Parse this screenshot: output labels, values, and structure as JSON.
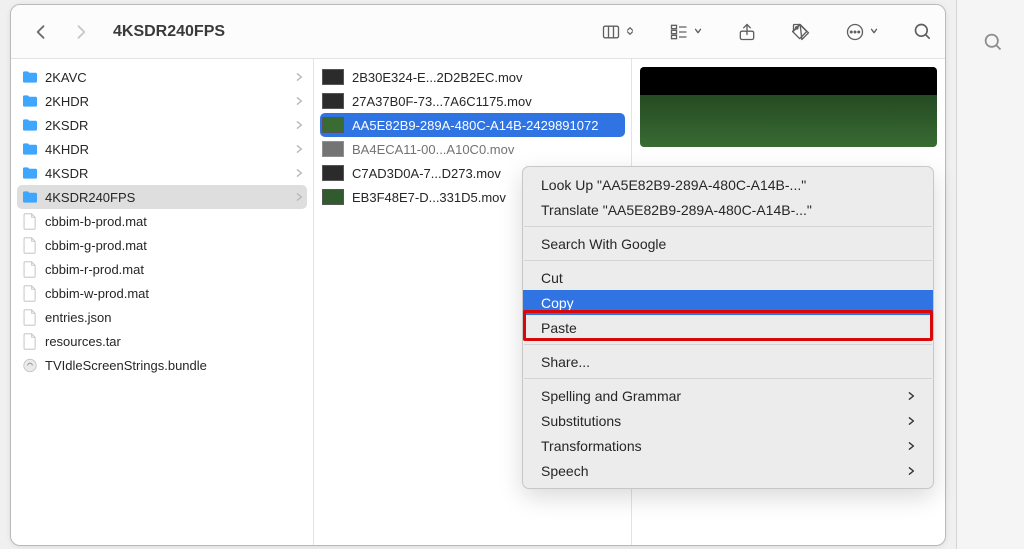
{
  "toolbar": {
    "title": "4KSDR240FPS"
  },
  "sidebar": {
    "items": [
      {
        "name": "2KAVC",
        "type": "folder",
        "selected": false
      },
      {
        "name": "2KHDR",
        "type": "folder",
        "selected": false
      },
      {
        "name": "2KSDR",
        "type": "folder",
        "selected": false
      },
      {
        "name": "4KHDR",
        "type": "folder",
        "selected": false
      },
      {
        "name": "4KSDR",
        "type": "folder",
        "selected": false
      },
      {
        "name": "4KSDR240FPS",
        "type": "folder",
        "selected": true
      },
      {
        "name": "cbbim-b-prod.mat",
        "type": "file",
        "selected": false
      },
      {
        "name": "cbbim-g-prod.mat",
        "type": "file",
        "selected": false
      },
      {
        "name": "cbbim-r-prod.mat",
        "type": "file",
        "selected": false
      },
      {
        "name": "cbbim-w-prod.mat",
        "type": "file",
        "selected": false
      },
      {
        "name": "entries.json",
        "type": "file",
        "selected": false
      },
      {
        "name": "resources.tar",
        "type": "file",
        "selected": false
      },
      {
        "name": "TVIdleScreenStrings.bundle",
        "type": "bundle",
        "selected": false
      }
    ]
  },
  "files": {
    "items": [
      {
        "name": "2B30E324-E...2D2B2EC.mov",
        "selected": false,
        "thumb": "#2b2b2b"
      },
      {
        "name": "27A37B0F-73...7A6C1175.mov",
        "selected": false,
        "thumb": "#2b2b2b"
      },
      {
        "name": "AA5E82B9-289A-480C-A14B-2429891072",
        "selected": true,
        "thumb": "#3a6b33"
      },
      {
        "name": "BA4ECA11-00...A10C0.mov",
        "selected": false,
        "strike": true,
        "thumb": "#2b2b2b"
      },
      {
        "name": "C7AD3D0A-7...D273.mov",
        "selected": false,
        "thumb": "#2b2b2b"
      },
      {
        "name": "EB3F48E7-D...331D5.mov",
        "selected": false,
        "thumb": "#315a2e"
      }
    ]
  },
  "context_menu": {
    "lookup": "Look Up \"AA5E82B9-289A-480C-A14B-...\"",
    "translate": "Translate \"AA5E82B9-289A-480C-A14B-...\"",
    "search": "Search With Google",
    "cut": "Cut",
    "copy": "Copy",
    "paste": "Paste",
    "share": "Share...",
    "spelling": "Spelling and Grammar",
    "subs": "Substitutions",
    "trans": "Transformations",
    "speech": "Speech"
  }
}
